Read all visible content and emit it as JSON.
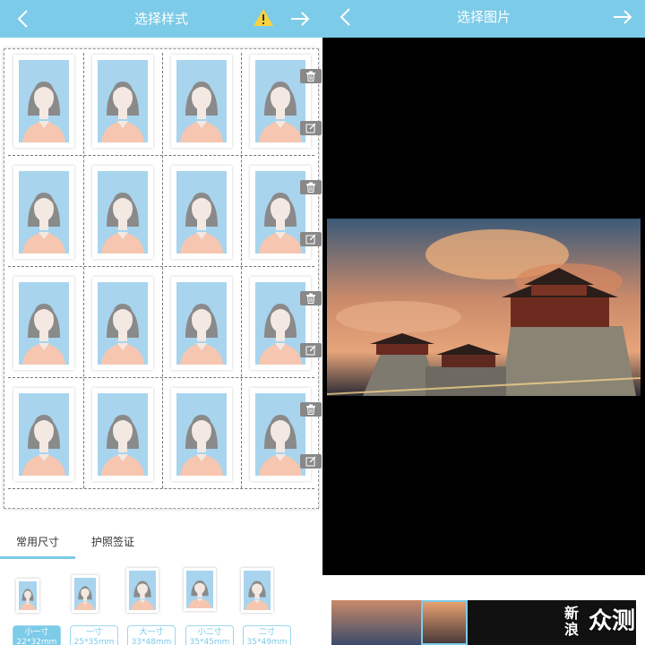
{
  "left_panel": {
    "title": "选择样式",
    "tabs": [
      {
        "label": "常用尺寸",
        "active": true
      },
      {
        "label": "护照签证",
        "active": false
      }
    ],
    "sizes": [
      {
        "label": "小一寸",
        "dims": "22*32mm",
        "selected": true
      },
      {
        "label": "一寸",
        "dims": "25*35mm",
        "selected": false
      },
      {
        "label": "大一寸",
        "dims": "33*48mm",
        "selected": false
      },
      {
        "label": "小二寸",
        "dims": "35*45mm",
        "selected": false
      },
      {
        "label": "二寸",
        "dims": "35*49mm",
        "selected": false
      }
    ],
    "icons": [
      "back-arrow-icon",
      "warning-icon",
      "forward-arrow-icon",
      "trash-icon",
      "edit-icon"
    ]
  },
  "right_panel": {
    "title": "选择图片",
    "watermark": "新浪众测"
  },
  "colors": {
    "accent": "#7ccbe8",
    "photo_background": "#a8d4ee",
    "hair": "#8a8a8a",
    "face": "#f3e9e2",
    "shirt": "#f6c6b0",
    "warning": "#f7d23c"
  }
}
